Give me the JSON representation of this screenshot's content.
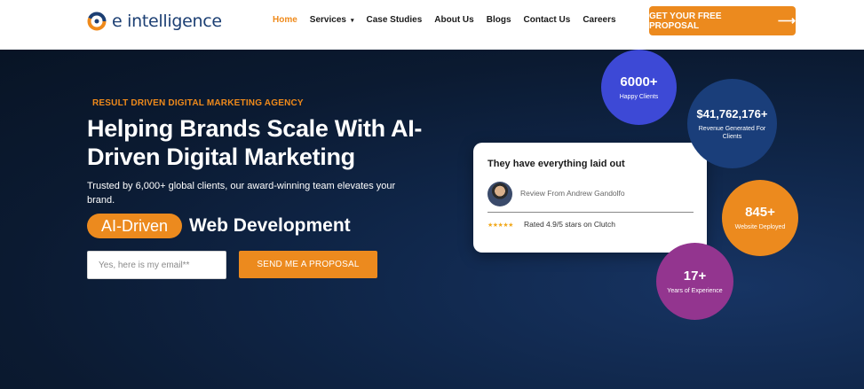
{
  "header": {
    "logo_text": "e intelligence",
    "nav": [
      {
        "label": "Home",
        "active": true
      },
      {
        "label": "Services",
        "caret": "▾"
      },
      {
        "label": "Case Studies"
      },
      {
        "label": "About Us"
      },
      {
        "label": "Blogs"
      },
      {
        "label": "Contact Us"
      },
      {
        "label": "Careers"
      }
    ],
    "cta_label": "GET YOUR FREE PROPOSAL",
    "cta_arrow": "⟶"
  },
  "hero": {
    "eyebrow": "RESULT DRIVEN DIGITAL MARKETING AGENCY",
    "headline": "Helping Brands Scale With AI-Driven Digital Marketing",
    "subtext": "Trusted by 6,000+ global clients, our award-winning team elevates your brand.",
    "rotator_pill": "AI-Driven",
    "rotator_text": "Web Development",
    "email_placeholder": "Yes, here is my email**",
    "submit_label": "SEND ME A PROPOSAL"
  },
  "review_card": {
    "title": "They have everything laid out",
    "reviewer": "Review From Andrew Gandolfo",
    "stars": "★★★★★",
    "rating_text": "Rated 4.9/5 stars on Clutch"
  },
  "stats": [
    {
      "value": "6000+",
      "label": "Happy Clients"
    },
    {
      "value": "$41,762,176+",
      "label": "Revenue Generated For Clients"
    },
    {
      "value": "845+",
      "label": "Website Deployed"
    },
    {
      "value": "17+",
      "label": "Years of Experience"
    }
  ],
  "colors": {
    "accent_orange": "#ec8a1e",
    "brand_blue": "#1c3f73",
    "stat_blue": "#3d49d6",
    "stat_navy": "#1a3e7a",
    "stat_purple": "#93358f"
  }
}
